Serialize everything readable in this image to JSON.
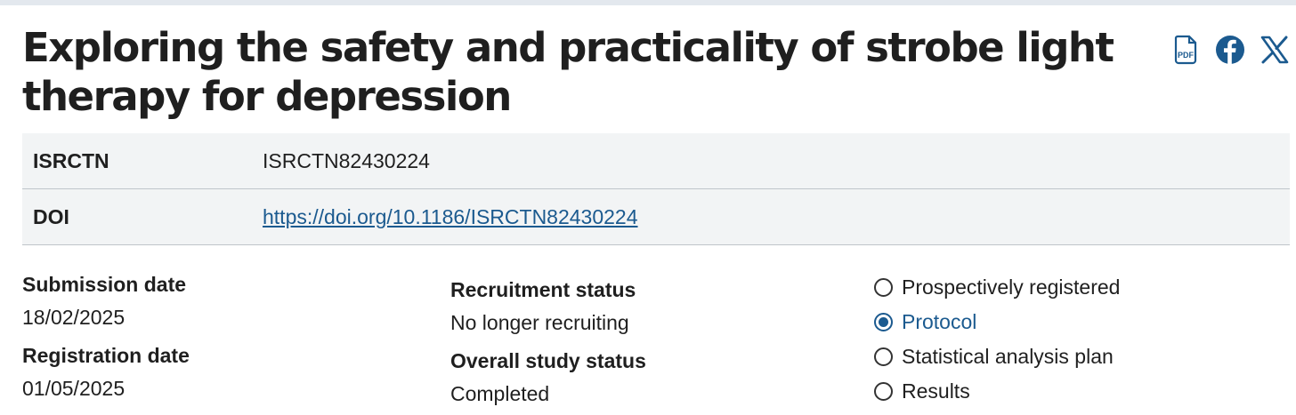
{
  "title": "Exploring the safety and practicality of strobe light therapy for depression",
  "share": {
    "pdf_label": "PDF",
    "icons": [
      "pdf-icon",
      "facebook-icon",
      "x-twitter-icon"
    ]
  },
  "identifiers": {
    "isrctn_label": "ISRCTN",
    "isrctn_value": "ISRCTN82430224",
    "doi_label": "DOI",
    "doi_value": "https://doi.org/10.1186/ISRCTN82430224"
  },
  "dates": {
    "submission_label": "Submission date",
    "submission_value": "18/02/2025",
    "registration_label": "Registration date",
    "registration_value": "01/05/2025"
  },
  "status": {
    "recruitment_label": "Recruitment status",
    "recruitment_value": "No longer recruiting",
    "overall_label": "Overall study status",
    "overall_value": "Completed"
  },
  "checklist": [
    {
      "label": "Prospectively registered",
      "checked": false
    },
    {
      "label": "Protocol",
      "checked": true
    },
    {
      "label": "Statistical analysis plan",
      "checked": false
    },
    {
      "label": "Results",
      "checked": false
    }
  ],
  "colors": {
    "link": "#1b5a8f",
    "table_bg": "#f2f4f5"
  }
}
